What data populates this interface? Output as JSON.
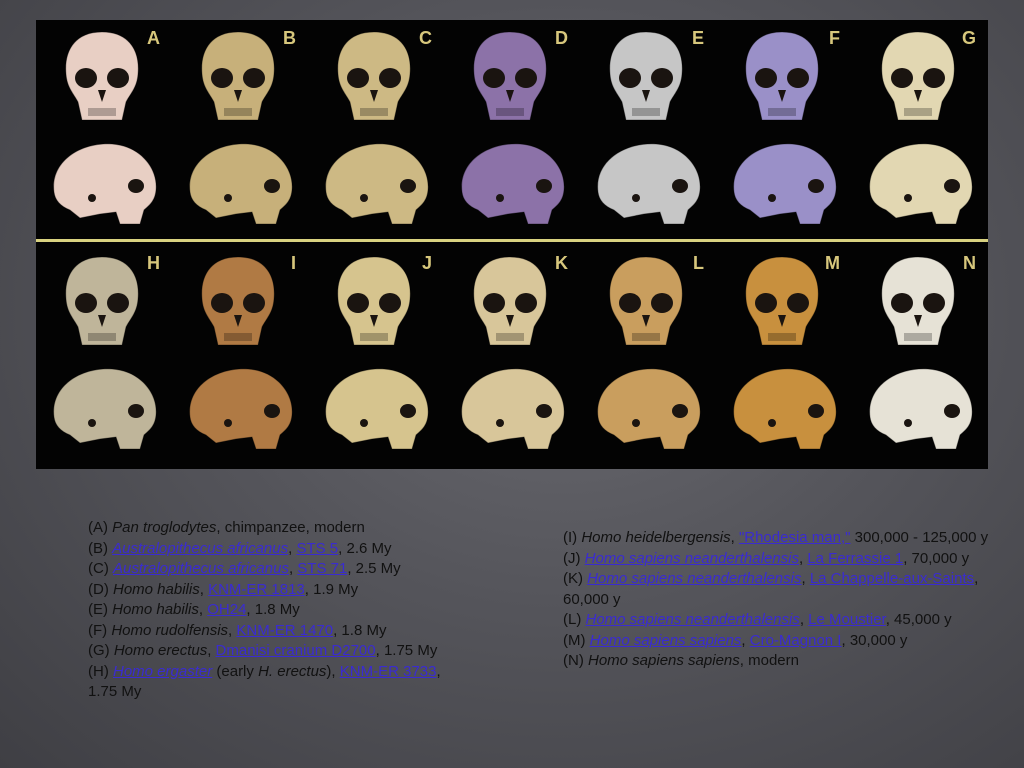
{
  "figure": {
    "letters": [
      "A",
      "B",
      "C",
      "D",
      "E",
      "F",
      "G",
      "H",
      "I",
      "J",
      "K",
      "L",
      "M",
      "N"
    ],
    "colors": {
      "A": "#e8cfc4",
      "B": "#c7b07a",
      "C": "#cdb984",
      "D": "#8c72a8",
      "E": "#c6c6c6",
      "F": "#9a90c8",
      "G": "#e2d7b2",
      "H": "#bfb59a",
      "I": "#b07a44",
      "J": "#d6c48e",
      "K": "#d8c69a",
      "L": "#c99e5e",
      "M": "#c8903e",
      "N": "#e6e2d6"
    },
    "divider_color": "#d9d280"
  },
  "captions_left": [
    {
      "letter": "(A) ",
      "species": "Pan troglodytes",
      "rest": ", chimpanzee, modern"
    },
    {
      "letter": "(B) ",
      "species_link": "Australopithecus africanus",
      "sep": ", ",
      "specimen_link": "STS 5",
      "rest": ", 2.6 My"
    },
    {
      "letter": "(C) ",
      "species_link": "Australopithecus africanus",
      "sep": ", ",
      "specimen_link": "STS 71",
      "rest": ", 2.5 My"
    },
    {
      "letter": "(D) ",
      "species": "Homo habilis",
      "sep": ", ",
      "specimen_link": "KNM-ER 1813",
      "rest": ", 1.9 My"
    },
    {
      "letter": "(E) ",
      "species": "Homo habilis",
      "sep": ", ",
      "specimen_link": "OH24",
      "rest": ", 1.8 My"
    },
    {
      "letter": "(F)  ",
      "species": "Homo rudolfensis",
      "sep": ", ",
      "specimen_link": "KNM-ER 1470",
      "rest": ", 1.8 My"
    },
    {
      "letter": "(G) ",
      "species": "Homo erectus",
      "sep": ", ",
      "specimen_link": "Dmanisi cranium D2700",
      "rest": ", 1.75 My"
    },
    {
      "letter": "(H) ",
      "species_link": " Homo ergaster",
      "mid": " (early ",
      "mid_italic": "H. erectus",
      "mid2": "), ",
      "specimen_link": "KNM-ER 3733",
      "rest": ", 1.75 My"
    }
  ],
  "captions_right": [
    {
      "letter": "(I) ",
      "species": "Homo heidelbergensis",
      "sep": ", ",
      "specimen_link": "\"Rhodesia man,\"",
      "rest": " 300,000 - 125,000 y"
    },
    {
      "letter": "(J) ",
      "species_link": "Homo sapiens neanderthalensis",
      "sep": ", ",
      "specimen_link": "La Ferrassie 1",
      "rest": ", 70,000 y"
    },
    {
      "letter": "(K) ",
      "species_link": "Homo sapiens neanderthalensis",
      "sep": ", ",
      "specimen_link": "La Chappelle-aux-Saints",
      "rest": ", 60,000 y"
    },
    {
      "letter": "(L) ",
      "species_link": "Homo sapiens neanderthalensis",
      "sep": ", ",
      "specimen_link": "Le Moustier",
      "rest": ", 45,000 y"
    },
    {
      "letter": "(M) ",
      "species_link": "Homo sapiens sapiens",
      "sep": ", ",
      "specimen_link": "Cro-Magnon I",
      "rest": ", 30,000 y"
    },
    {
      "letter": "(N) ",
      "species": "Homo sapiens sapiens",
      "rest": ", modern"
    }
  ]
}
